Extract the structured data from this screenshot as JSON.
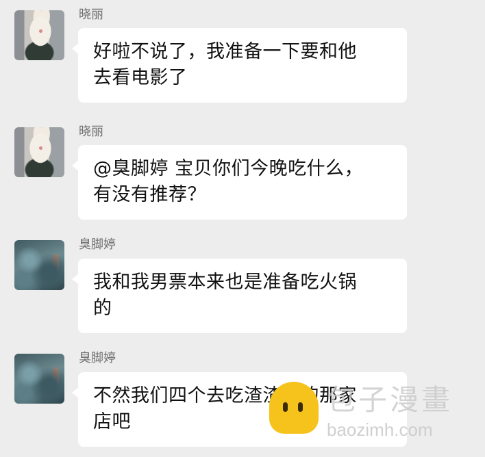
{
  "messages": [
    {
      "sender": "晓丽",
      "avatar_icon": "rabbit-avatar",
      "lines": [
        "好啦不说了，我准备一下要和他",
        "去看电影了"
      ]
    },
    {
      "sender": "晓丽",
      "avatar_icon": "rabbit-avatar",
      "lines": [
        "@臭脚婷 宝贝你们今晚吃什么，",
        "有没有推荐？"
      ]
    },
    {
      "sender": "臭脚婷",
      "avatar_icon": "water-avatar",
      "lines": [
        "我和我男票本来也是准备吃火锅",
        "的"
      ]
    },
    {
      "sender": "臭脚婷",
      "avatar_icon": "water-avatar",
      "lines": [
        "不然我们四个去吃渣渣说的那家",
        "店吧"
      ]
    }
  ],
  "watermark": {
    "title": "包子漫畫",
    "url": "baozimh.com",
    "logo_color": "#f6c21c"
  }
}
